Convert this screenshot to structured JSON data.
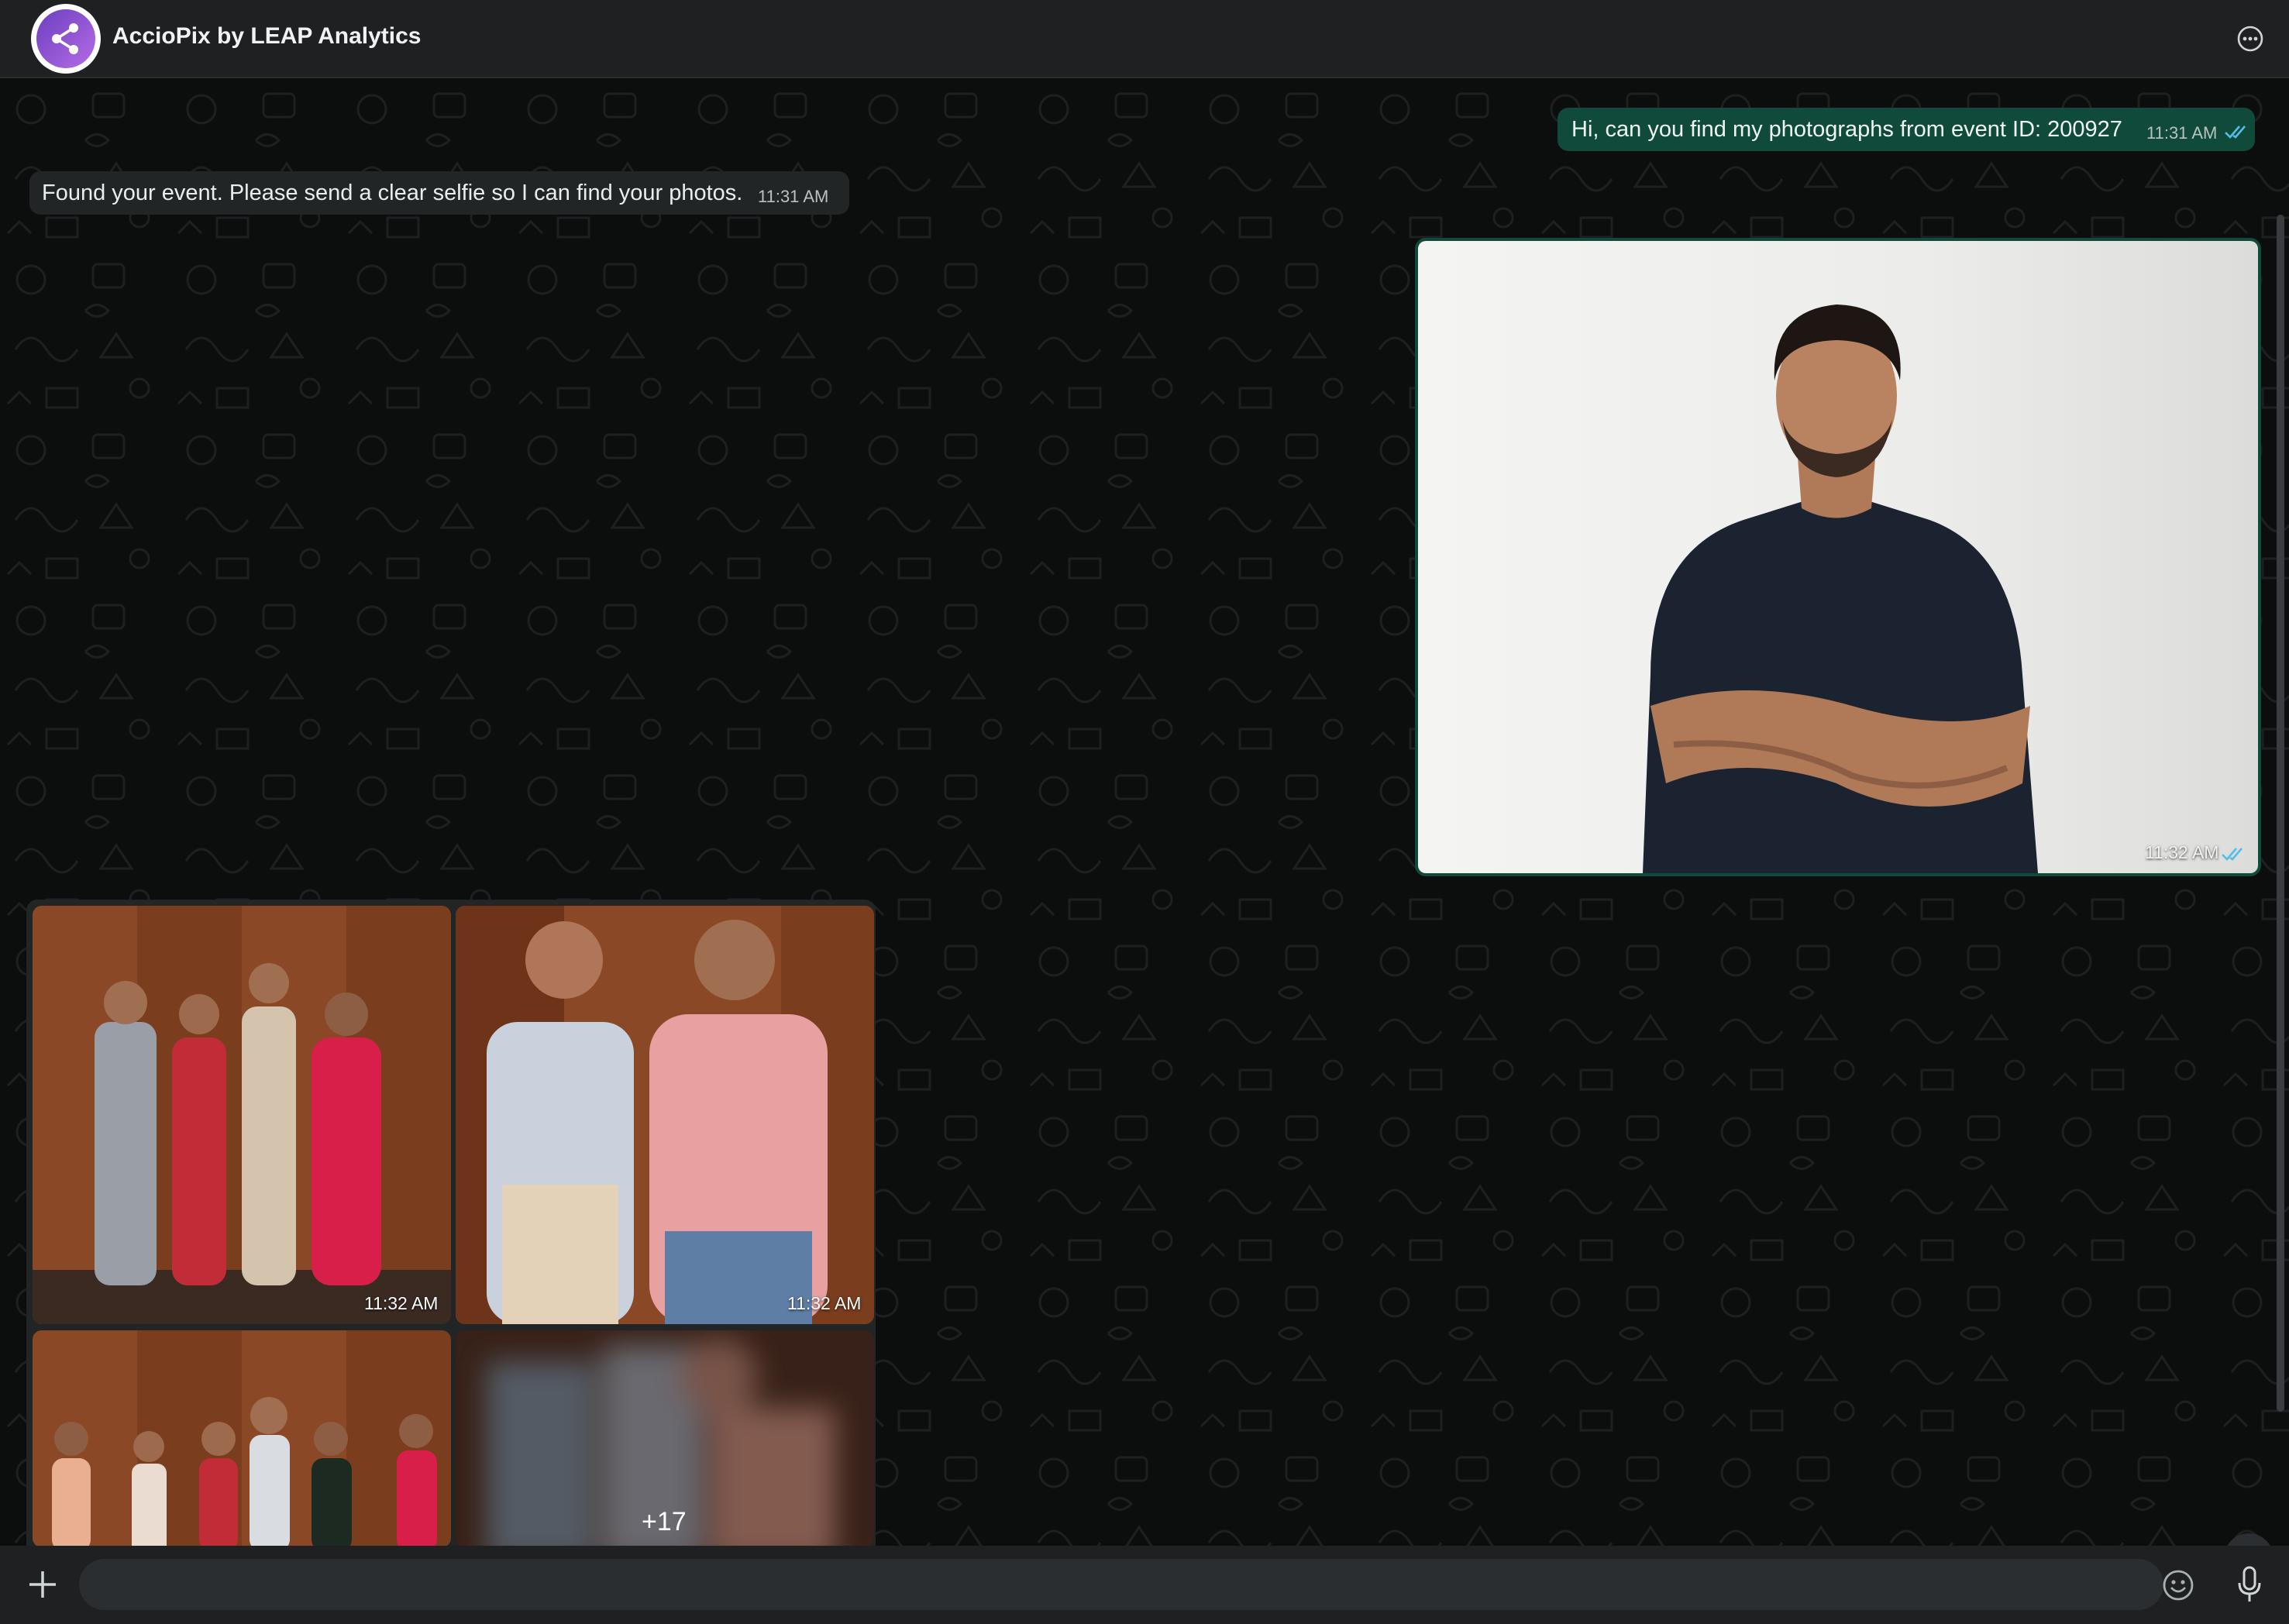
{
  "header": {
    "title": "AccioPix by LEAP Analytics",
    "avatar_icon": "share-network-icon",
    "menu_icon": "more-options-icon"
  },
  "messages": [
    {
      "direction": "outgoing",
      "text": "Hi, can you find my photographs from event ID: 200927",
      "time": "11:31 AM",
      "status": "read"
    },
    {
      "direction": "incoming",
      "text": "Found your event. Please send a clear selfie so I can find your photos.",
      "time": "11:31 AM"
    },
    {
      "direction": "outgoing",
      "type": "image",
      "content": "selfie",
      "time": "11:32 AM",
      "status": "read"
    },
    {
      "direction": "incoming",
      "type": "album",
      "photos": [
        {
          "time": "11:32 AM"
        },
        {
          "time": "11:32 AM"
        },
        {
          "time": ""
        },
        {
          "more_count": "+17"
        }
      ]
    }
  ],
  "composer": {
    "placeholder": "",
    "attach_icon": "plus-icon",
    "emoji_icon": "emoji-icon",
    "mic_icon": "microphone-icon"
  },
  "colors": {
    "header_bg": "#1e2021",
    "chat_bg": "#0c0d0d",
    "outgoing_bubble": "#0f4a3b",
    "incoming_bubble": "#212526",
    "read_ticks": "#53bdeb"
  }
}
